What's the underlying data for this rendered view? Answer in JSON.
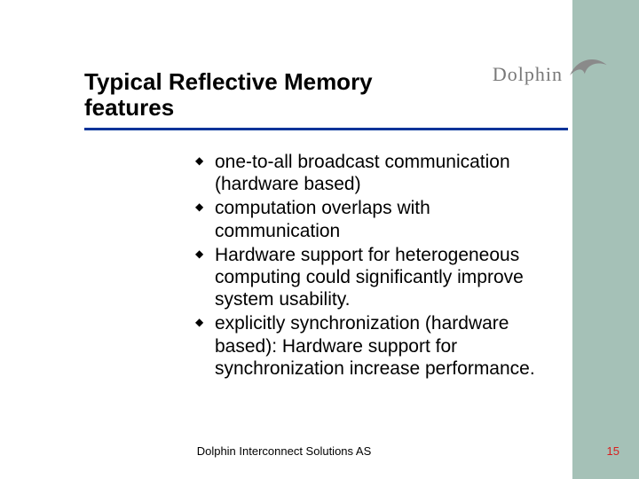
{
  "title": "Typical Reflective Memory features",
  "logo": {
    "text": "Dolphin",
    "icon": "dolphin-icon"
  },
  "bullets": [
    "one-to-all broadcast communication (hardware based)",
    "computation overlaps with communication",
    "Hardware support for heterogeneous computing could significantly improve system usability.",
    "explicitly synchronization (hardware based): Hardware support for synchronization increase performance."
  ],
  "footer": "Dolphin Interconnect Solutions AS",
  "page_number": "15"
}
